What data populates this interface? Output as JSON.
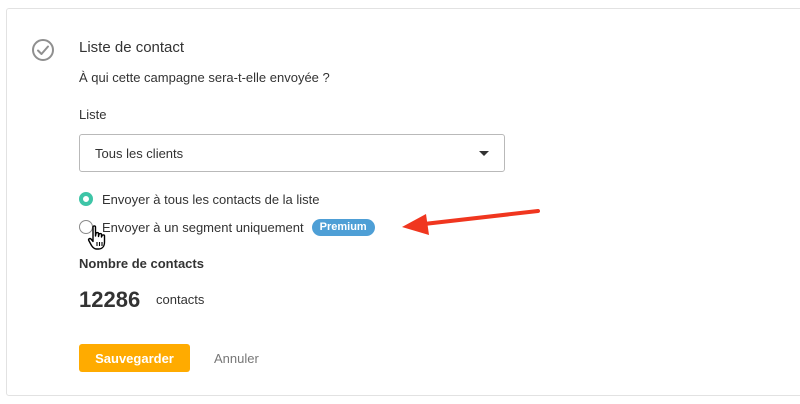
{
  "section": {
    "icon": "check-circle-icon",
    "title": "Liste de contact",
    "subtitle": "À qui cette campagne sera-t-elle envoyée ?"
  },
  "list_field": {
    "label": "Liste",
    "selected": "Tous les clients"
  },
  "recipients": {
    "options": [
      {
        "label": "Envoyer à tous les contacts de la liste",
        "checked": true
      },
      {
        "label": "Envoyer à un segment uniquement",
        "checked": false,
        "badge": "Premium"
      }
    ]
  },
  "contacts": {
    "label": "Nombre de contacts",
    "count": "12286",
    "unit": "contacts"
  },
  "actions": {
    "save_label": "Sauvegarder",
    "cancel_label": "Annuler"
  },
  "colors": {
    "accent_green": "#3ec5a7",
    "save_orange": "#ffab00",
    "badge_blue": "#4e9fd6",
    "arrow_red": "#f0361f"
  },
  "annotations": {
    "arrow": "red-arrow-icon",
    "cursor": "hand-cursor-icon"
  }
}
